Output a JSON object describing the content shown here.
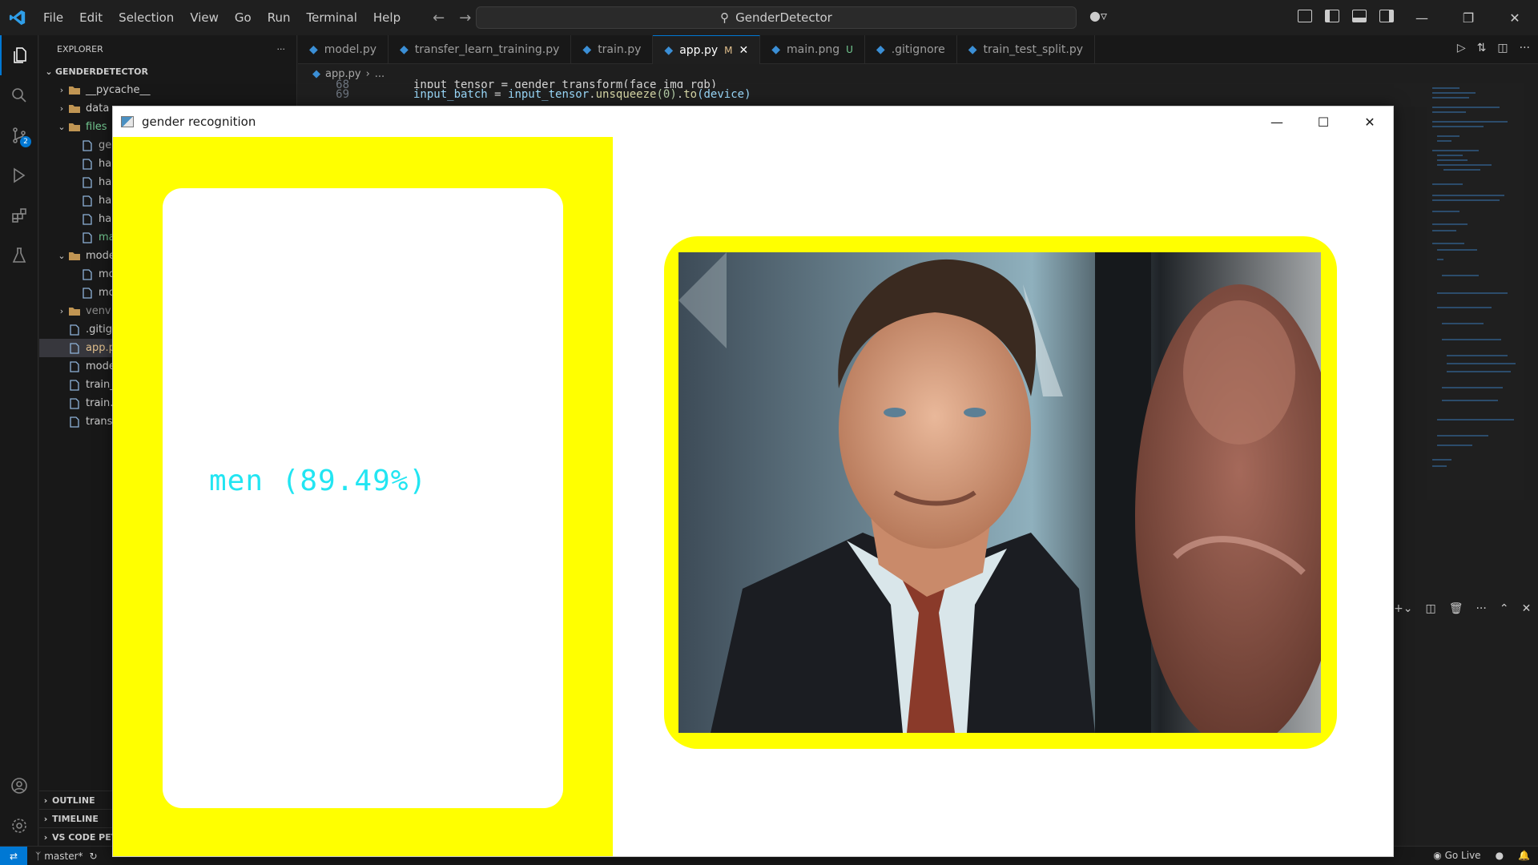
{
  "titlebar": {
    "menu": [
      "File",
      "Edit",
      "Selection",
      "View",
      "Go",
      "Run",
      "Terminal",
      "Help"
    ],
    "search": "GenderDetector"
  },
  "explorer": {
    "header": "EXPLORER",
    "project": "GENDERDETECTOR",
    "tree": [
      {
        "label": "__pycache__",
        "kind": "folder",
        "indent": 1,
        "chevron": "closed",
        "color": "#cccccc"
      },
      {
        "label": "data",
        "kind": "folder",
        "indent": 1,
        "chevron": "closed",
        "color": "#cccccc"
      },
      {
        "label": "files",
        "kind": "folder",
        "indent": 1,
        "chevron": "open",
        "color": "#73c991"
      },
      {
        "label": "gen",
        "kind": "file",
        "indent": 2,
        "color": "#a9a9a9"
      },
      {
        "label": "haa",
        "kind": "file",
        "indent": 2,
        "color": "#cccccc"
      },
      {
        "label": "haa",
        "kind": "file",
        "indent": 2,
        "color": "#cccccc"
      },
      {
        "label": "haa",
        "kind": "file",
        "indent": 2,
        "color": "#cccccc"
      },
      {
        "label": "haa",
        "kind": "file",
        "indent": 2,
        "color": "#cccccc"
      },
      {
        "label": "mai",
        "kind": "file",
        "indent": 2,
        "color": "#73c991"
      },
      {
        "label": "mode",
        "kind": "folder",
        "indent": 1,
        "chevron": "open",
        "color": "#cccccc"
      },
      {
        "label": "mol",
        "kind": "file",
        "indent": 2,
        "color": "#cccccc"
      },
      {
        "label": "moc",
        "kind": "file",
        "indent": 2,
        "color": "#cccccc"
      },
      {
        "label": "venv",
        "kind": "folder",
        "indent": 1,
        "chevron": "closed",
        "color": "#8b8b8b"
      },
      {
        "label": ".gitig",
        "kind": "file",
        "indent": 1,
        "color": "#cccccc"
      },
      {
        "label": "app.p",
        "kind": "file",
        "indent": 1,
        "color": "#e2c08d",
        "selected": true
      },
      {
        "label": "mode",
        "kind": "file",
        "indent": 1,
        "color": "#cccccc"
      },
      {
        "label": "train_",
        "kind": "file",
        "indent": 1,
        "color": "#cccccc"
      },
      {
        "label": "train.",
        "kind": "file",
        "indent": 1,
        "color": "#cccccc"
      },
      {
        "label": "trans",
        "kind": "file",
        "indent": 1,
        "color": "#cccccc"
      }
    ],
    "sections": [
      "OUTLINE",
      "TIMELINE",
      "VS CODE PET"
    ]
  },
  "tabs": [
    {
      "label": "model.py",
      "active": false
    },
    {
      "label": "transfer_learn_training.py",
      "active": false
    },
    {
      "label": "train.py",
      "active": false
    },
    {
      "label": "app.py",
      "active": true,
      "badge": "M"
    },
    {
      "label": "main.png",
      "active": false,
      "badge": "U"
    },
    {
      "label": ".gitignore",
      "active": false
    },
    {
      "label": "train_test_split.py",
      "active": false
    }
  ],
  "breadcrumb": {
    "file": "app.py",
    "more": "..."
  },
  "code": {
    "line_number": "69",
    "prev_line_number": "68",
    "prev_text": "input_tensor = gender_transform(face_img_rgb)",
    "text_var": "input_batch",
    "text_eq": " = ",
    "text_obj": "input_tensor",
    "text_dot1": ".",
    "text_fn1": "unsqueeze",
    "text_arg": "(0)",
    "text_dot2": ".",
    "text_fn2": "to",
    "text_arg2": "(device)"
  },
  "statusbar": {
    "branch": "master*",
    "golive": "Go Live"
  },
  "cv_window": {
    "title": "gender recognition",
    "result_text": "men (89.49%)",
    "panel_color": "#ffff00",
    "text_color": "#22e5f2"
  }
}
